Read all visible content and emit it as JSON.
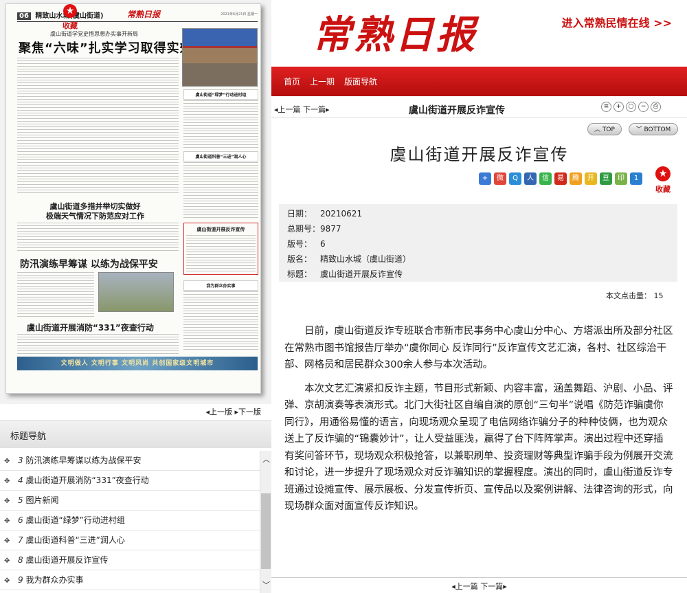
{
  "header": {
    "logo": "常熟日报",
    "minqing_link": "进入常熟民情在线 >>"
  },
  "nav": {
    "items": [
      "首页",
      "上一期",
      "版面导航"
    ]
  },
  "paper": {
    "page_no": "06",
    "page_name": "精致山水城(虞山街道)",
    "brand": "常熟日报",
    "date": "2021年6月21日 星期一",
    "fav_label": "收藏",
    "subtitle": "虞山街道学党史悟思想办实事开新局",
    "headline": "聚焦“六味”扎实学习取得实效",
    "headline2": "虞山街道多措并举切实做好\n极端天气情况下防范应对工作",
    "headline3": "防汛演练早筹谋 以练为战保平安",
    "headline4": "虞山街道开展消防“331”夜查行动",
    "side1": "虞山街道“绿梦”行动进村组",
    "side2": "虞山街道科普“三进”润人心",
    "side3": "虞山街道开展反诈宣传",
    "side4": "我为群众办实事",
    "banner": "文明做人  文明行事  文明风尚  共创国家级文明城市"
  },
  "page_nav": {
    "prev": "上一版",
    "next": "下一版"
  },
  "title_nav": {
    "header": "标题导航",
    "items": [
      {
        "no": "3",
        "title": "防汛演练早筹谋以练为战保平安"
      },
      {
        "no": "4",
        "title": "虞山街道开展消防“331”夜查行动"
      },
      {
        "no": "5",
        "title": "图片新闻"
      },
      {
        "no": "6",
        "title": "虞山街道“绿梦”行动进村组"
      },
      {
        "no": "7",
        "title": "虞山街道科普“三进”润人心"
      },
      {
        "no": "8",
        "title": "虞山街道开展反诈宣传"
      },
      {
        "no": "9",
        "title": "我为群众办实事"
      }
    ]
  },
  "article": {
    "nav_prev": "上一篇",
    "nav_next": "下一篇",
    "toolbar_title": "虞山街道开展反诈宣传",
    "top_label": "TOP",
    "bottom_label": "BOTTOM",
    "title": "虞山街道开展反诈宣传",
    "fav_label": "收藏",
    "meta": {
      "date_label": "日期：",
      "date": "20210621",
      "issue_label": "总期号：",
      "issue": "9877",
      "page_label": "版号：",
      "page": "6",
      "pname_label": "版名：",
      "pname": "精致山水城（虞山街道）",
      "title_label": "标题：",
      "title": "虞山街道开展反诈宣传"
    },
    "word_count_label": "本文点击量：",
    "word_count": "15",
    "paragraphs": [
      "日前，虞山街道反诈专班联合市新市民事务中心虞山分中心、方塔派出所及部分社区在常熟市图书馆报告厅举办“虞你同心 反诈同行”反诈宣传文艺汇演，各村、社区综治干部、网格员和居民群众300余人参与本次活动。",
      "本次文艺汇演紧扣反诈主题，节目形式新颖、内容丰富，涵盖舞蹈、沪剧、小品、评弹、京胡演奏等表演形式。北门大街社区自编自演的原创“三句半”说唱《防范诈骗虞你同行》，用通俗易懂的语言，向现场观众呈现了电信网络诈骗分子的种种伎俩，也为观众送上了反诈骗的“锦囊妙计”，让人受益匪浅，赢得了台下阵阵掌声。演出过程中还穿插有奖问答环节，现场观众积极抢答，以兼职刷单、投资理财等典型诈骗手段为例展开交流和讨论，进一步提升了现场观众对反诈骗知识的掌握程度。演出的同时，虞山街道反诈专班通过设摊宣传、展示展板、分发宣传折页、宣传品以及案例讲解、法律咨询的形式，向现场群众面对面宣传反诈知识。"
    ]
  },
  "colors": {
    "brand_red": "#cc1111",
    "nav_red": "#d01818"
  },
  "icons": [
    "star-icon",
    "print-icon",
    "zoom-in-icon",
    "zoom-out-icon",
    "scroll-up-icon",
    "scroll-down-icon"
  ]
}
